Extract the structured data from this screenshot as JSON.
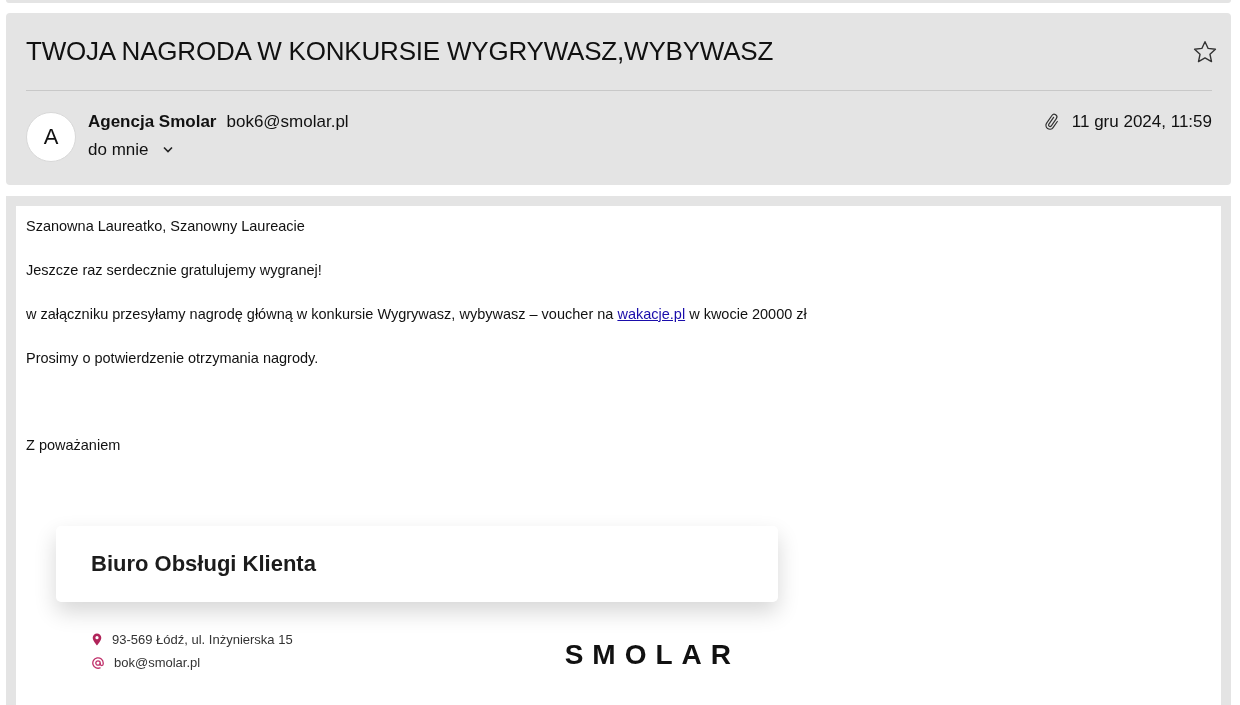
{
  "message": {
    "subject": "TWOJA NAGRODA W KONKURSIE WYGRYWASZ,WYBYWASZ",
    "starred": false,
    "sender": {
      "avatar_letter": "A",
      "name": "Agencja Smolar",
      "email": "bok6@smolar.pl",
      "recipient": "do mnie"
    },
    "has_attachment": true,
    "date": "11 gru 2024, 11:59"
  },
  "body": {
    "paragraphs": [
      [
        {
          "kind": "text",
          "text": "Szanowna Laureatko, Szanowny Laureacie"
        }
      ],
      [
        {
          "kind": "text",
          "text": "Jeszcze raz serdecznie gratulujemy wygranej!"
        }
      ],
      [
        {
          "kind": "text",
          "text": "w załączniku przesyłamy nagrodę główną w konkursie Wygrywasz, wybywasz – voucher na "
        },
        {
          "kind": "link",
          "text": "wakacje.pl"
        },
        {
          "kind": "text",
          "text": " w kwocie 20000 zł"
        }
      ],
      [
        {
          "kind": "text",
          "text": "Prosimy o potwierdzenie otrzymania nagrody."
        }
      ]
    ],
    "closing": "Z poważaniem"
  },
  "signature": {
    "title": "Biuro Obsługi Klienta",
    "address": "93-569 Łódź, ul. Inżynierska 15",
    "email": "bok@smolar.pl",
    "logo": "SMOLAR"
  }
}
